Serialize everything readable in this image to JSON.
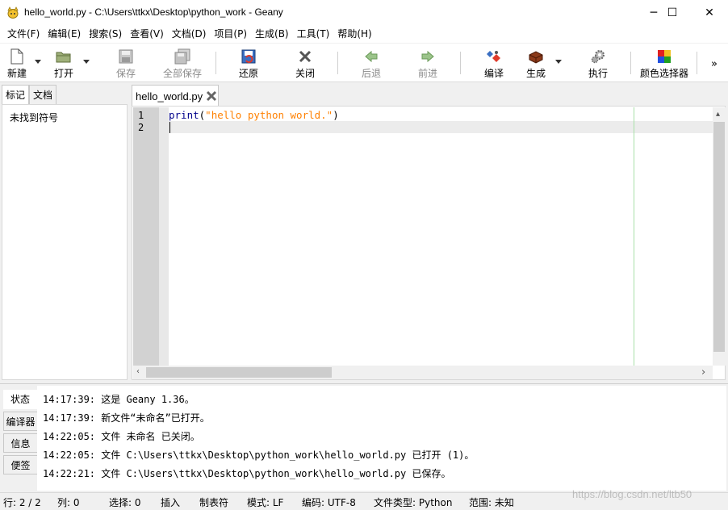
{
  "window": {
    "title": "hello_world.py - C:\\Users\\ttkx\\Desktop\\python_work - Geany",
    "controls": {
      "minimize": "─",
      "maximize": "☐",
      "close": "✕"
    }
  },
  "menubar": {
    "items": [
      "文件(F)",
      "编辑(E)",
      "搜索(S)",
      "查看(V)",
      "文档(D)",
      "项目(P)",
      "生成(B)",
      "工具(T)",
      "帮助(H)"
    ]
  },
  "toolbar": {
    "new": "新建",
    "open": "打开",
    "save": "保存",
    "save_all": "全部保存",
    "revert": "还原",
    "close": "关闭",
    "back": "后退",
    "forward": "前进",
    "compile": "编译",
    "build": "生成",
    "run": "执行",
    "color_chooser": "颜色选择器",
    "more": "»"
  },
  "sidebar": {
    "tabs": [
      "标记",
      "文档"
    ],
    "empty_text": "未找到符号"
  },
  "editor": {
    "tab_name": "hello_world.py",
    "line_numbers": [
      "1",
      "2"
    ],
    "code": {
      "keyword": "print",
      "open": "(",
      "string": "\"hello python world.\"",
      "close": ")"
    }
  },
  "messages": {
    "tabs": [
      "状态",
      "编译器",
      "信息",
      "便签"
    ],
    "lines": [
      "14:17:39: 这是 Geany 1.36。",
      "14:17:39: 新文件“未命名”已打开。",
      "14:22:05: 文件 未命名 已关闭。",
      "14:22:05: 文件 C:\\Users\\ttkx\\Desktop\\python_work\\hello_world.py 已打开 (1)。",
      "14:22:21: 文件 C:\\Users\\ttkx\\Desktop\\python_work\\hello_world.py 已保存。"
    ]
  },
  "statusbar": {
    "line": "行: 2 / 2",
    "col": "列: 0",
    "sel": "选择: 0",
    "insert": "插入",
    "tabs": "制表符",
    "mode": "模式: LF",
    "encoding": "编码: UTF-8",
    "filetype": "文件类型: Python",
    "scope": "范围: 未知"
  },
  "watermark": "https://blog.csdn.net/ltb50"
}
